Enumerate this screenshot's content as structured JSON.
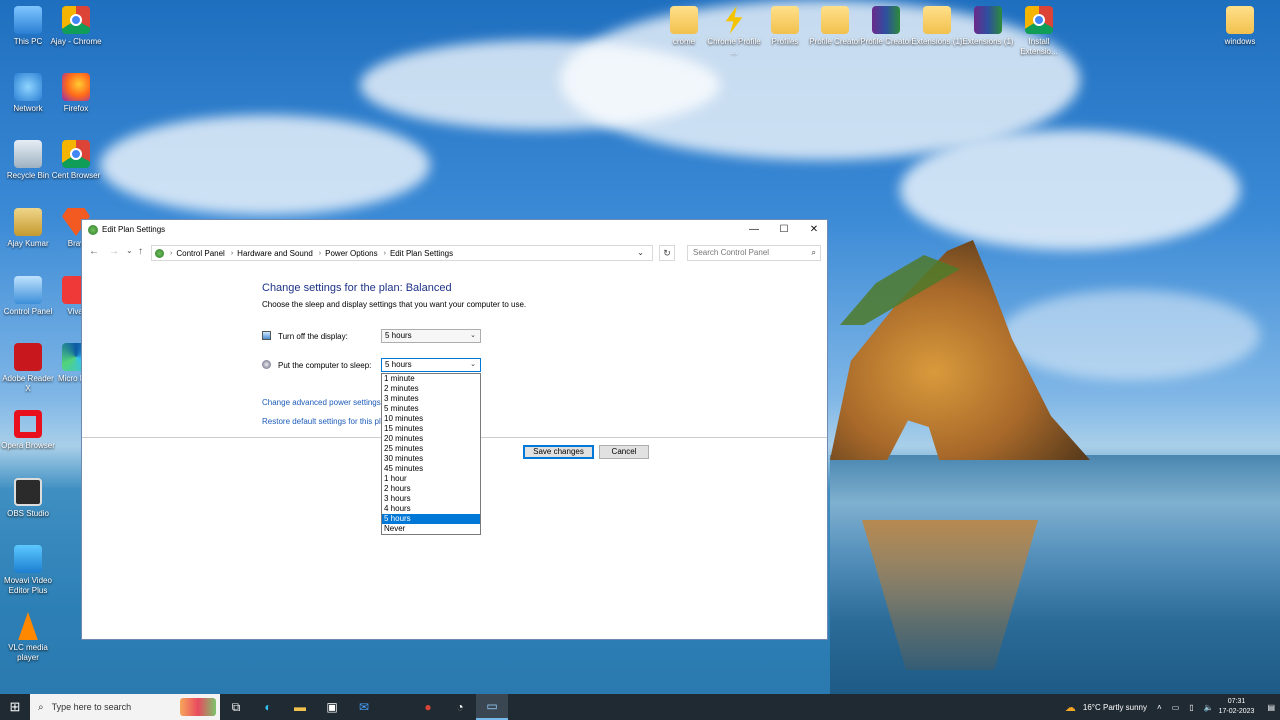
{
  "desktop": {
    "left_icons": [
      {
        "label": "This PC",
        "icon": "computer-icon"
      },
      {
        "label": "Ajay - Chrome",
        "icon": "chrome-icon"
      },
      {
        "label": "Network",
        "icon": "network-icon"
      },
      {
        "label": "Firefox",
        "icon": "firefox-icon"
      },
      {
        "label": "Recycle Bin",
        "icon": "recycle-bin-icon"
      },
      {
        "label": "Cent Browser",
        "icon": "cent-browser-icon"
      },
      {
        "label": "Ajay Kumar",
        "icon": "user-folder-icon"
      },
      {
        "label": "Brav",
        "icon": "brave-icon"
      },
      {
        "label": "Control Panel",
        "icon": "control-panel-icon"
      },
      {
        "label": "Vival",
        "icon": "vivaldi-icon"
      },
      {
        "label": "Adobe Reader X",
        "icon": "adobe-reader-icon"
      },
      {
        "label": "Micro Edg",
        "icon": "edge-icon"
      },
      {
        "label": "Opera Browser",
        "icon": "opera-icon"
      },
      {
        "label": "OBS Studio",
        "icon": "obs-icon"
      },
      {
        "label": "Movavi Video Editor Plus",
        "icon": "movavi-icon"
      },
      {
        "label": "VLC media player",
        "icon": "vlc-icon"
      }
    ],
    "top_icons": [
      {
        "label": "crome",
        "icon": "folder-icon"
      },
      {
        "label": "Chrome Profile ...",
        "icon": "lightning-icon"
      },
      {
        "label": "Profiles",
        "icon": "folder-icon"
      },
      {
        "label": "Profile Creator",
        "icon": "folder-icon"
      },
      {
        "label": "Profile Creator",
        "icon": "winrar-icon"
      },
      {
        "label": "Extensions (1)",
        "icon": "folder-icon"
      },
      {
        "label": "Extensions (1)",
        "icon": "winrar-icon"
      },
      {
        "label": "Install Extensio...",
        "icon": "chrome-icon"
      },
      {
        "label": "windows",
        "icon": "folder-icon"
      }
    ]
  },
  "window": {
    "title": "Edit Plan Settings",
    "controls": {
      "minimize": "—",
      "maximize": "☐",
      "close": "✕"
    },
    "nav": {
      "back": "←",
      "forward": "→",
      "recent": "⌄",
      "up": "↑"
    },
    "breadcrumb": [
      "Control Panel",
      "Hardware and Sound",
      "Power Options",
      "Edit Plan Settings"
    ],
    "search_placeholder": "Search Control Panel",
    "heading": "Change settings for the plan: Balanced",
    "subheading": "Choose the sleep and display settings that you want your computer to use.",
    "display_label": "Turn off the display:",
    "display_value": "5 hours",
    "sleep_label": "Put the computer to sleep:",
    "sleep_value": "5 hours",
    "sleep_options": [
      "1 minute",
      "2 minutes",
      "3 minutes",
      "5 minutes",
      "10 minutes",
      "15 minutes",
      "20 minutes",
      "25 minutes",
      "30 minutes",
      "45 minutes",
      "1 hour",
      "2 hours",
      "3 hours",
      "4 hours",
      "5 hours",
      "Never"
    ],
    "sleep_selected_index": 14,
    "link_advanced": "Change advanced power settings",
    "link_restore": "Restore default settings for this pla",
    "save_label": "Save changes",
    "cancel_label": "Cancel"
  },
  "taskbar": {
    "search_placeholder": "Type here to search",
    "weather": "16°C  Partly sunny",
    "time": "07:31",
    "date": "17-02-2023"
  }
}
